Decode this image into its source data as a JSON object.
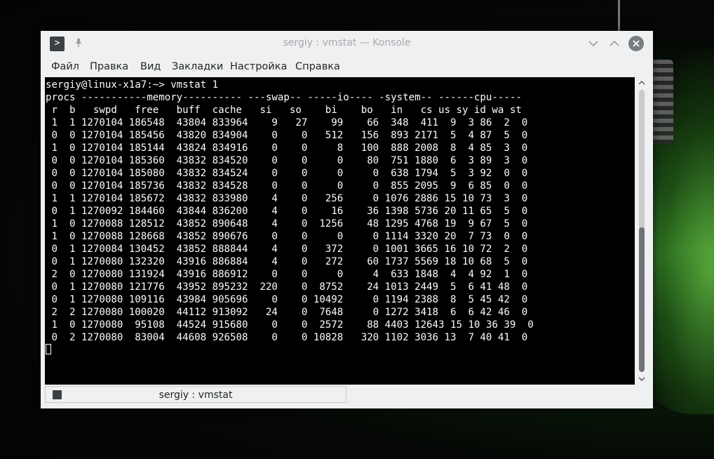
{
  "window": {
    "title": "sergiy : vmstat — Konsole"
  },
  "menu": [
    "Файл",
    "Правка",
    "Вид",
    "Закладки",
    "Настройка",
    "Справка"
  ],
  "terminal": {
    "lines": [
      "sergiy@linux-x1a7:~> vmstat 1",
      "procs -----------memory---------- ---swap-- -----io---- -system-- ------cpu-----",
      " r  b   swpd   free   buff  cache   si   so    bi    bo   in   cs us sy id wa st",
      " 1  1 1270104 186548  43804 833964    9   27    99    66  348  411  9  3 86  2  0",
      " 0  0 1270104 185456  43820 834904    0    0   512   156  893 2171  5  4 87  5  0",
      " 1  0 1270104 185144  43824 834916    0    0     8   100  888 2008  8  4 85  3  0",
      " 0  0 1270104 185360  43832 834520    0    0     0    80  751 1880  6  3 89  3  0",
      " 0  0 1270104 185080  43832 834524    0    0     0     0  638 1794  5  3 92  0  0",
      " 0  0 1270104 185736  43832 834528    0    0     0     0  855 2095  9  6 85  0  0",
      " 1  1 1270104 185672  43832 833980    4    0   256     0 1076 2886 15 10 73  3  0",
      " 0  1 1270092 184460  43844 836200    4    0    16    36 1398 5736 20 11 65  5  0",
      " 1  0 1270088 128512  43852 890648    4    0  1256    48 1295 4768 19  9 67  5  0",
      " 1  0 1270088 128668  43852 890676    0    0     0     0 1114 3320 20  7 73  0  0",
      " 0  1 1270084 130452  43852 888844    4    0   372     0 1001 3665 16 10 72  2  0",
      " 0  1 1270080 132320  43916 886884    4    0   272    60 1737 5569 18 10 68  5  0",
      " 2  0 1270080 131924  43916 886912    0    0     0     4  633 1848  4  4 92  1  0",
      " 0  1 1270080 121776  43952 895232  220    0  8752    24 1013 2449  5  6 41 48  0",
      " 0  1 1270080 109116  43984 905696    0    0 10492     0 1194 2388  8  5 45 42  0",
      " 2  2 1270080 100020  44112 913092   24    0  7648     0 1272 3418  6  6 42 46  0",
      " 1  0 1270080  95108  44524 915680    0    0  2572    88 4403 12643 15 10 36 39  0",
      " 0  2 1270080  83004  44608 926508    0    0 10828   320 1102 3036 13  7 40 41  0"
    ]
  },
  "tab": {
    "label": "sergiy : vmstat"
  },
  "icons": {
    "app": "terminal-icon",
    "pin": "pin-icon",
    "minimize": "chevron-down-icon",
    "maximize": "chevron-up-icon",
    "close": "close-icon"
  }
}
